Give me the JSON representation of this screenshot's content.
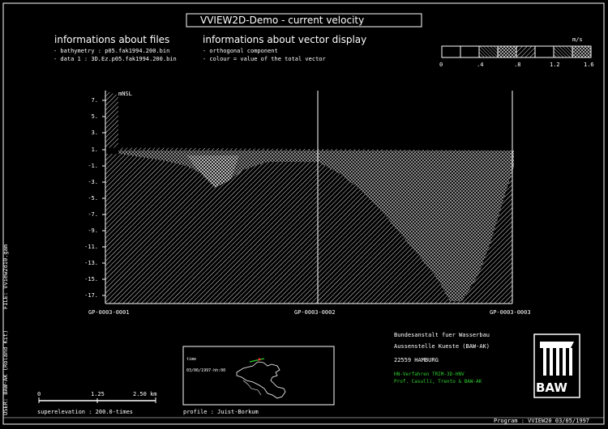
{
  "title": "VVIEW2D-Demo  -  current velocity",
  "files": {
    "heading": "informations about files",
    "bathymetry": "- bathymetry :      p05.fak1994.200.bin",
    "data": "- data 1 :      3D.Ez.p05.fak1994.200.bin"
  },
  "vectors": {
    "heading": "informations about vector display",
    "line1": "- orthogonal component",
    "line2": "- colour = value of the total vector"
  },
  "scale_bar": {
    "unit": "m/s",
    "ticks": [
      "0",
      ".4",
      ".8",
      "1.2",
      "1.6"
    ]
  },
  "profile_chart": {
    "y_label": "mNSL",
    "y_ticks": [
      "7.",
      "5.",
      "3.",
      "1.",
      "-1.",
      "-3.",
      "-5.",
      "-7.",
      "-9.",
      "-11.",
      "-13.",
      "-15.",
      "-17."
    ],
    "stations": [
      "GP-0003-0001",
      "GP-0003-0002",
      "GP-0003-0003"
    ]
  },
  "km_scale": {
    "ticks": [
      "0",
      "1.25",
      "2.50 km"
    ],
    "superelevation": "superelevation :     200.0-times"
  },
  "map": {
    "label_a": "time",
    "label_b": "03/06/1997-hh:00",
    "profile": "profile :    Juist-Borkum"
  },
  "institution": {
    "line1": "Bundesanstalt fuer Wasserbau",
    "line2": "Aussenstelle Kueste (BAW-AK)",
    "line3": "22559 HAMBURG",
    "green1": "HN-Verfahren TRIM-3D-HNV",
    "green2": "Prof. Casulli, Trento & BAW-AK",
    "logo": "BAW"
  },
  "side_labels": {
    "user": "USER: BAW-AK (Roland Kit)",
    "file": "FILE: Vview2d10.gam"
  },
  "footer": "Program : VVIEW20       03/05/1997"
}
